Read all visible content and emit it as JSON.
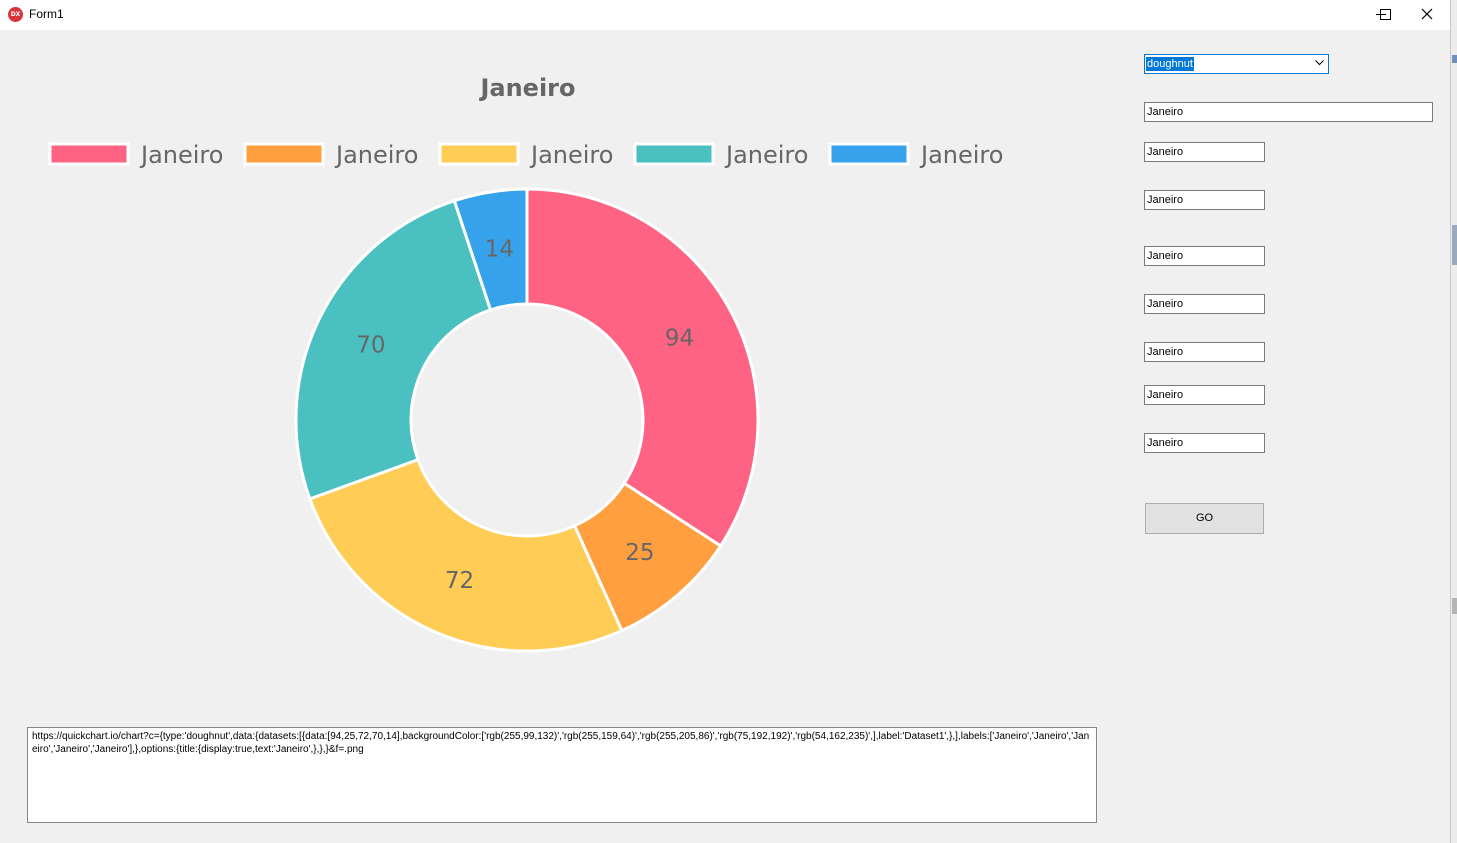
{
  "window": {
    "title": "Form1",
    "icon": "dx-app-icon",
    "controls": [
      "minimize-icon",
      "maximize-icon",
      "close-icon"
    ]
  },
  "chart_data": {
    "type": "doughnut",
    "title": "Janeiro",
    "categories": [
      "Janeiro",
      "Janeiro",
      "Janeiro",
      "Janeiro",
      "Janeiro"
    ],
    "values": [
      94,
      25,
      72,
      70,
      14
    ],
    "colors": [
      "#ff6384",
      "#ff9f40",
      "#ffcd56",
      "#4bc0c0",
      "#36a2eb"
    ],
    "legend_position": "top",
    "data_labels": true
  },
  "controls": {
    "chart_type": "doughnut",
    "title_field": "Janeiro",
    "label_fields": [
      "Janeiro",
      "Janeiro",
      "Janeiro",
      "Janeiro",
      "Janeiro",
      "Janeiro",
      "Janeiro"
    ],
    "go_label": "GO"
  },
  "memo": {
    "text": "https://quickchart.io/chart?c={type:'doughnut',data:{datasets:[{data:[94,25,72,70,14],backgroundColor:['rgb(255,99,132)','rgb(255,159,64)','rgb(255,205,86)','rgb(75,192,192)','rgb(54,162,235)',],label:'Dataset1',},],labels:['Janeiro','Janeiro','Janeiro','Janeiro','Janeiro'],},options:{title:{display:true,text:'Janeiro',},},}&f=.png"
  }
}
